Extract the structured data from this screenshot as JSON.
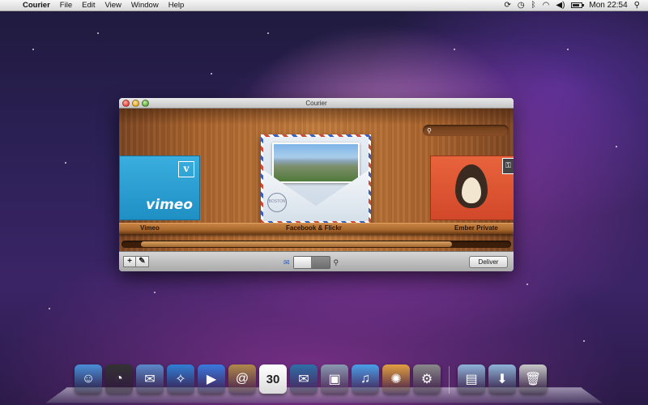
{
  "menubar": {
    "app_name": "Courier",
    "menus": [
      "File",
      "Edit",
      "View",
      "Window",
      "Help"
    ],
    "clock": "Mon 22:54",
    "status_icons": [
      "sync-icon",
      "time-machine-icon",
      "bluetooth-icon",
      "wifi-icon",
      "volume-icon",
      "battery-icon",
      "spotlight-icon"
    ]
  },
  "window": {
    "title": "Courier",
    "search": {
      "placeholder": "",
      "value": ""
    },
    "services": [
      {
        "label": "Vimeo",
        "brand": "vimeo",
        "badge": "v",
        "color": "#1f8fc4"
      },
      {
        "label": "Facebook & Flickr",
        "stamp": "BOSTON"
      },
      {
        "label": "Ember Private",
        "color": "#d2482a"
      }
    ],
    "toolbar": {
      "add_label": "+",
      "edit_label": "✎",
      "deliver_label": "Deliver"
    }
  },
  "dock": {
    "apps": [
      {
        "name": "finder",
        "glyph": "☺",
        "color": "#4a90d9"
      },
      {
        "name": "dashboard",
        "glyph": "◔",
        "color": "#333333"
      },
      {
        "name": "mail",
        "glyph": "✉",
        "color": "#5c8acb"
      },
      {
        "name": "safari",
        "glyph": "✧",
        "color": "#2f7fd6"
      },
      {
        "name": "ichat",
        "glyph": "▶",
        "color": "#3a7ae0"
      },
      {
        "name": "address-book",
        "glyph": "@",
        "color": "#b08a4a"
      },
      {
        "name": "ical",
        "glyph": "30",
        "color": "#f2f2f2"
      },
      {
        "name": "courier",
        "glyph": "✉",
        "color": "#2f6fa8"
      },
      {
        "name": "preview",
        "glyph": "▣",
        "color": "#8a9bb0"
      },
      {
        "name": "itunes",
        "glyph": "♫",
        "color": "#4aa0e8"
      },
      {
        "name": "iphoto",
        "glyph": "✺",
        "color": "#e2a040"
      },
      {
        "name": "system-preferences",
        "glyph": "⚙",
        "color": "#8a8a8a"
      }
    ],
    "stacks": [
      {
        "name": "applications-folder",
        "glyph": "▤",
        "color": "#8fb4d8"
      },
      {
        "name": "downloads-folder",
        "glyph": "⬇",
        "color": "#8fb4d8"
      },
      {
        "name": "trash",
        "glyph": "🗑",
        "color": "#c8c8c8"
      }
    ]
  }
}
